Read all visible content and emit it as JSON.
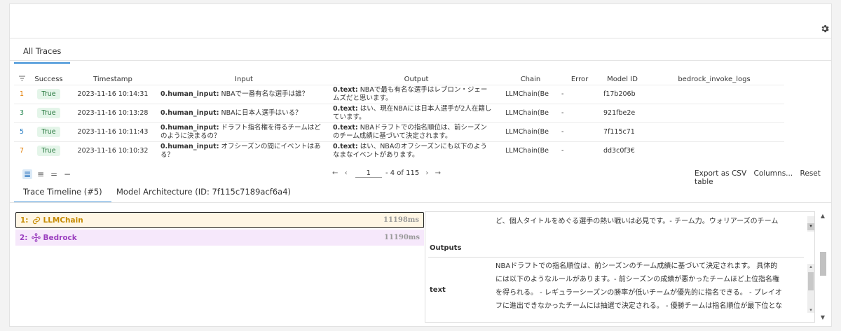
{
  "tabs_top": {
    "all_traces": "All Traces"
  },
  "table": {
    "headers": [
      "Success",
      "Timestamp",
      "Input",
      "Output",
      "Chain",
      "Error",
      "Model ID",
      "bedrock_invoke_logs"
    ],
    "rows": [
      {
        "idx": "1",
        "idx_color": "#e07b00",
        "success": "True",
        "timestamp": "2023-11-16 10:14:31",
        "input_key": "0.human_input:",
        "input_text": "NBAで一番有名な選手は誰？",
        "input_text2": "",
        "output_key": "0.text:",
        "output_text": "NBAで最も有名な選手はレブロン・ジェー",
        "output_text2": "ムズだと思います。",
        "chain": "LLMChain(Be",
        "error": "-",
        "model_id": "f17b206b"
      },
      {
        "idx": "3",
        "idx_color": "#2e8b57",
        "success": "True",
        "timestamp": "2023-11-16 10:13:28",
        "input_key": "0.human_input:",
        "input_text": "NBAに日本人選手はいる？",
        "input_text2": "",
        "output_key": "0.text:",
        "output_text": "はい、現在NBAには日本人選手が2人在籍し",
        "output_text2": "ています。",
        "chain": "LLMChain(Be",
        "error": "-",
        "model_id": "921fbe2e"
      },
      {
        "idx": "5",
        "idx_color": "#2b7fc3",
        "success": "True",
        "timestamp": "2023-11-16 10:11:43",
        "input_key": "0.human_input:",
        "input_text": "ドラフト指名権を得るチームはど",
        "input_text2": "のように決まるの？",
        "output_key": "0.text:",
        "output_text": "NBAドラフトでの指名順位は、前シーズン",
        "output_text2": "のチーム成績に基づいて決定されます。",
        "chain": "LLMChain(Be",
        "error": "-",
        "model_id": "7f115c71"
      },
      {
        "idx": "7",
        "idx_color": "#e07b00",
        "success": "True",
        "timestamp": "2023-11-16 10:10:32",
        "input_key": "0.human_input:",
        "input_text": "オフシーズンの間にイベントはあ",
        "input_text2": "る？",
        "output_key": "0.text:",
        "output_text": "はい、NBAのオフシーズンにも以下のよう",
        "output_text2": "なまなイベントがあります。",
        "chain": "LLMChain(Be",
        "error": "-",
        "model_id": "dd3c0f3€"
      }
    ]
  },
  "pagination": {
    "first": "←",
    "prev": "‹",
    "page": "1",
    "range": "- 4 of 115",
    "next": "›",
    "last": "→"
  },
  "actions": {
    "export": "Export as CSV",
    "columns": "Columns...",
    "reset": "Reset table"
  },
  "tabs_bottom": {
    "timeline": "Trace Timeline (#5)",
    "model": "Model Architecture (ID: 7f115c7189acf6a4)"
  },
  "spans": [
    {
      "num": "1:",
      "name": "LLMChain",
      "duration": "11198ms",
      "color": "#c58a00"
    },
    {
      "num": "2:",
      "name": "Bedrock",
      "duration": "11190ms",
      "color": "#9b3fbf"
    }
  ],
  "detail": {
    "top_text": "ど、個人タイトルをめぐる選手の熱い戦いは必見です。- チーム力。ウォリアーズのチーム",
    "outputs_label": "Outputs",
    "field_label": "text",
    "lines": [
      "NBAドラフトでの指名順位は、前シーズンのチーム成績に基づいて決定されます。 具体的",
      "には以下のようなルールがあります。- 前シーズンの成績が悪かったチームほど上位指名権",
      "を得られる。 - レギュラーシーズンの勝率が低いチームが優先的に指名できる。 - プレイオ",
      "フに進出できなかったチームには抽選で決定される。 - 優勝チームは指名順位が最下位とな"
    ]
  },
  "colors": {
    "accent": "#3d8fd6",
    "success_bg": "#e4f5e9",
    "success_fg": "#2e7d44",
    "chain_bg": "#fff6e4",
    "bedrock_bg": "#f6e8fb"
  }
}
